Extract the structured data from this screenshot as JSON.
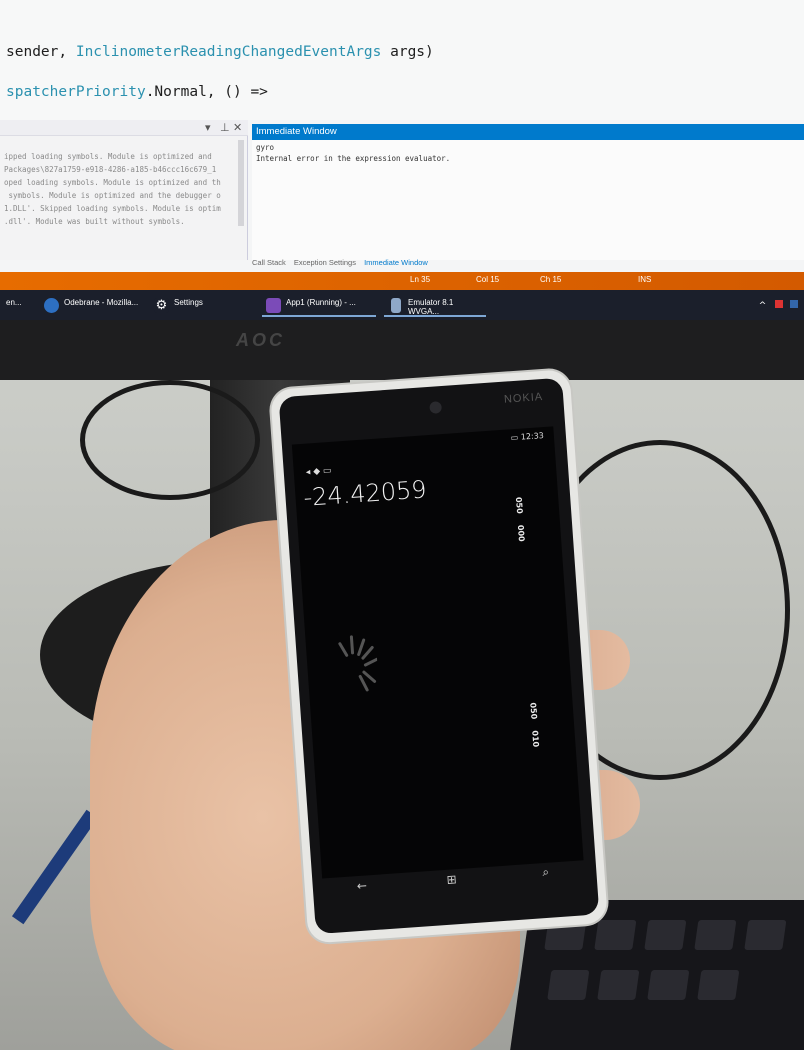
{
  "editor": {
    "line1_prefix": "sender, ",
    "line1_type": "InclinometerReadingChangedEventArgs",
    "line1_suffix": " args)",
    "line2_type": "spatcherPriority",
    "line2_suffix": ".Normal, () =>"
  },
  "output": {
    "lines": [
      "ipped loading symbols. Module is optimized and",
      "Packages\\827a1759-e918-4286-a185-b46ccc16c679_1",
      "oped loading symbols. Module is optimized and th",
      " symbols. Module is optimized and the debugger o",
      "1.DLL'. Skipped loading symbols. Module is optim",
      ".dll'. Module was built without symbols."
    ]
  },
  "immediate": {
    "title": "Immediate Window",
    "line1": "gyro",
    "line2": "Internal error in the expression evaluator."
  },
  "tabs": [
    "Call Stack",
    "Exception Settings",
    "Immediate Window"
  ],
  "statusbar": {
    "ln": "Ln 35",
    "col": "Col 15",
    "ch": "Ch 15",
    "mode": "INS"
  },
  "taskbar": {
    "items": [
      {
        "label": "en..."
      },
      {
        "label": "Odebrane - Mozilla..."
      },
      {
        "label": "Settings"
      },
      {
        "label": "App1 (Running) - ..."
      },
      {
        "label": "Emulator 8.1 WVGA..."
      }
    ]
  },
  "monitor_brand": "AOC",
  "phone": {
    "brand": "NOKIA",
    "time": "12:33",
    "reading": "-24.42059",
    "ticks": [
      "050",
      "000",
      "050",
      "010"
    ]
  },
  "colors": {
    "accent": "#007acc",
    "statusbar": "#e76c00",
    "taskbar": "#1b1f2b"
  }
}
